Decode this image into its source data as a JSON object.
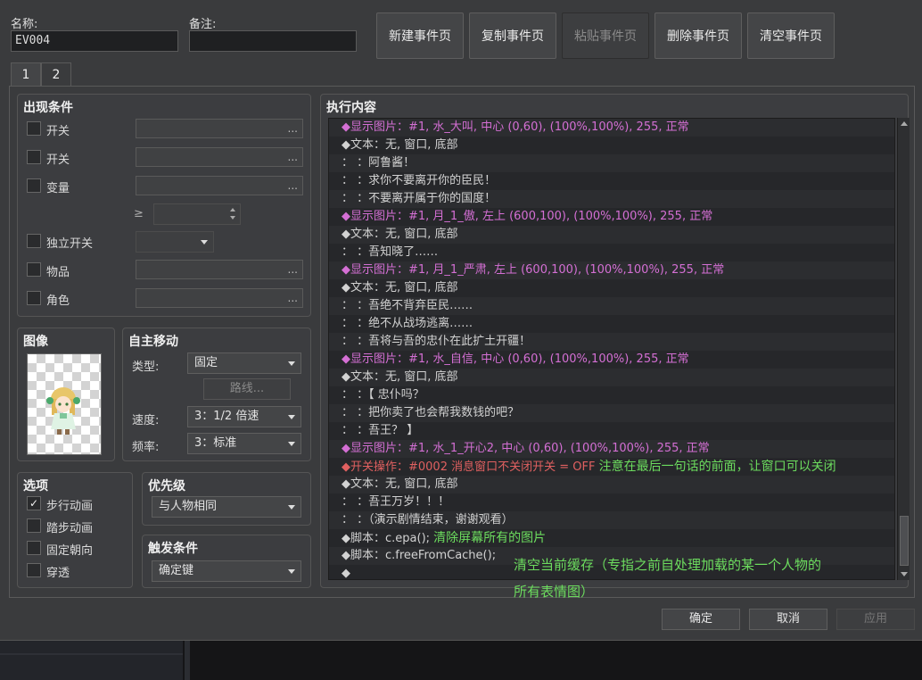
{
  "header": {
    "name_label": "名称:",
    "name_value": "EV004",
    "note_label": "备注:",
    "note_value": "",
    "buttons": {
      "new_page": "新建事件页",
      "copy_page": "复制事件页",
      "paste_page": "粘贴事件页",
      "delete_page": "删除事件页",
      "clear_page": "清空事件页"
    }
  },
  "tabs": [
    "1",
    "2"
  ],
  "conditions": {
    "title": "出现条件",
    "switch1": "开关",
    "switch2": "开关",
    "variable": "变量",
    "ge_symbol": "≥",
    "self_switch": "独立开关",
    "item": "物品",
    "actor": "角色",
    "ellipsis": "..."
  },
  "image": {
    "title": "图像"
  },
  "autonomous": {
    "title": "自主移动",
    "type_label": "类型:",
    "type_value": "固定",
    "route_button": "路线...",
    "speed_label": "速度:",
    "speed_value": "3：1/2 倍速",
    "freq_label": "频率:",
    "freq_value": "3：标准"
  },
  "options": {
    "title": "选项",
    "walk_anim": {
      "label": "步行动画",
      "checked": true
    },
    "step_anim": {
      "label": "踏步动画",
      "checked": false
    },
    "dir_fix": {
      "label": "固定朝向",
      "checked": false
    },
    "through": {
      "label": "穿透",
      "checked": false
    }
  },
  "priority": {
    "title": "优先级",
    "value": "与人物相同"
  },
  "trigger": {
    "title": "触发条件",
    "value": "确定键"
  },
  "contents": {
    "title": "执行内容",
    "lines": [
      {
        "text": "◆显示图片：#1, 水_大叫, 中心 (0,60), (100%,100%), 255, 正常",
        "color": "pink",
        "note": ""
      },
      {
        "text": "◆文本：无, 窗口, 底部",
        "color": "normal",
        "note": ""
      },
      {
        "text": "：        ：阿鲁酱！",
        "color": "normal",
        "note": ""
      },
      {
        "text": "：        ：求你不要离开你的臣民！",
        "color": "normal",
        "note": ""
      },
      {
        "text": "：        ：不要离开属于你的国度！",
        "color": "normal",
        "note": ""
      },
      {
        "text": "◆显示图片：#1, 月_1_傲, 左上 (600,100), (100%,100%), 255, 正常",
        "color": "pink",
        "note": ""
      },
      {
        "text": "◆文本：无, 窗口, 底部",
        "color": "normal",
        "note": ""
      },
      {
        "text": "：        ：吾知晓了……",
        "color": "normal",
        "note": ""
      },
      {
        "text": "◆显示图片：#1, 月_1_严肃, 左上 (600,100), (100%,100%), 255, 正常",
        "color": "pink",
        "note": ""
      },
      {
        "text": "◆文本：无, 窗口, 底部",
        "color": "normal",
        "note": ""
      },
      {
        "text": "：        ：吾绝不背弃臣民……",
        "color": "normal",
        "note": ""
      },
      {
        "text": "：        ：绝不从战场逃离……",
        "color": "normal",
        "note": ""
      },
      {
        "text": "：        ：吾将与吾的忠仆在此扩土开疆！",
        "color": "normal",
        "note": ""
      },
      {
        "text": "◆显示图片：#1, 水_自信, 中心 (0,60), (100%,100%), 255, 正常",
        "color": "pink",
        "note": ""
      },
      {
        "text": "◆文本：无, 窗口, 底部",
        "color": "normal",
        "note": ""
      },
      {
        "text": "：        ：【 忠仆吗？",
        "color": "normal",
        "note": ""
      },
      {
        "text": "：        ：把你卖了也会帮我数钱的吧？",
        "color": "normal",
        "note": ""
      },
      {
        "text": "：        ：吾王？ 】",
        "color": "normal",
        "note": ""
      },
      {
        "text": "◆显示图片：#1, 水_1_开心2, 中心 (0,60), (100%,100%), 255, 正常",
        "color": "pink",
        "note": ""
      },
      {
        "text": "◆开关操作：#0002 消息窗口不关闭开关 = OFF ",
        "color": "red",
        "note": "注意在最后一句话的前面，让窗口可以关闭"
      },
      {
        "text": "◆文本：无, 窗口, 底部",
        "color": "normal",
        "note": ""
      },
      {
        "text": "：        ：吾王万岁！！！",
        "color": "normal",
        "note": ""
      },
      {
        "text": "：        ：（演示剧情结束，谢谢观看）",
        "color": "normal",
        "note": ""
      },
      {
        "text": "◆脚本：c.epa();  ",
        "color": "normal",
        "note": "清除屏幕所有的图片"
      },
      {
        "text": "◆脚本：c.freeFromCache();",
        "color": "normal",
        "note": ""
      },
      {
        "text": "◆",
        "color": "normal",
        "note": ""
      }
    ],
    "annotation_line1": "清空当前缓存（专指之前自处理加载的某一个人物的",
    "annotation_line2": "所有表情图）"
  },
  "footer": {
    "ok": "确定",
    "cancel": "取消",
    "apply": "应用"
  },
  "colors": {
    "pink": "#d46fd4",
    "red": "#e06060",
    "note_green": "#6cdc5e"
  }
}
